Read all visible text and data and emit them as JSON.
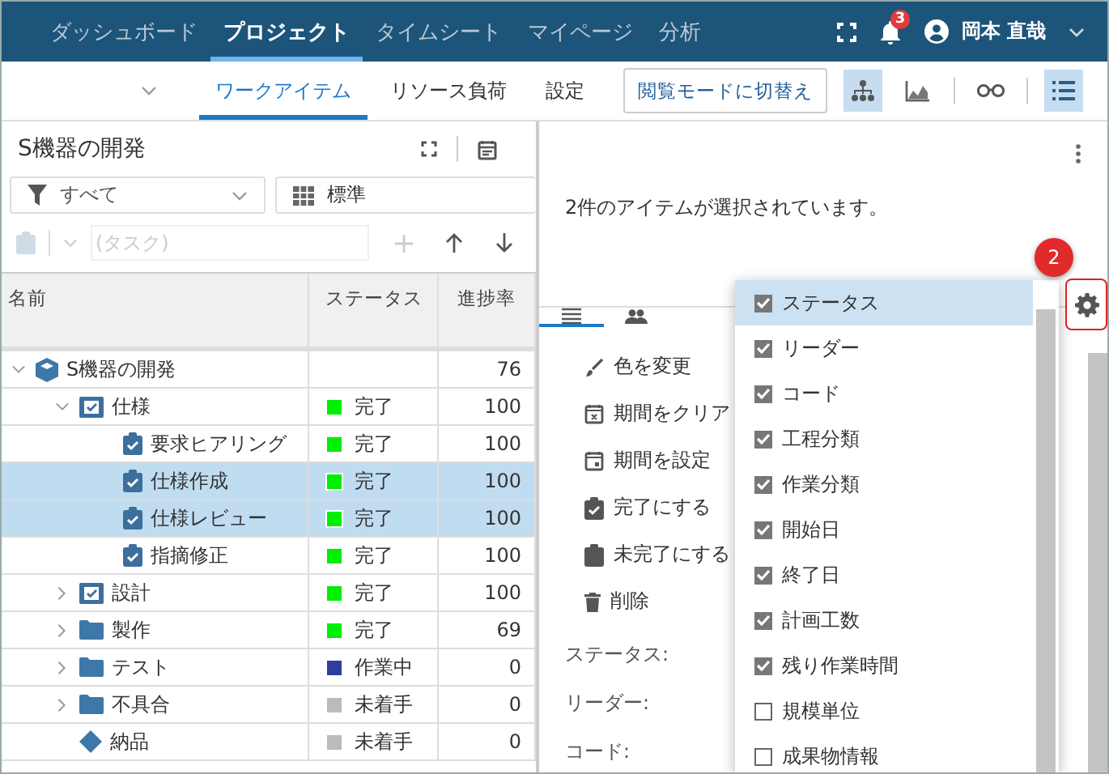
{
  "nav": {
    "items": [
      {
        "label": "ダッシュボード",
        "selected": false
      },
      {
        "label": "プロジェクト",
        "selected": true
      },
      {
        "label": "タイムシート",
        "selected": false
      },
      {
        "label": "マイページ",
        "selected": false
      },
      {
        "label": "分析",
        "selected": false
      }
    ],
    "notification_count": "3",
    "user_name": "岡本 直哉"
  },
  "subnav": {
    "tabs": [
      {
        "label": "ワークアイテム",
        "selected": true
      },
      {
        "label": "リソース負荷",
        "selected": false
      },
      {
        "label": "設定",
        "selected": false
      }
    ],
    "mode_button": "閲覧モードに切替え",
    "view_buttons": [
      {
        "kind": "hierarchy",
        "selected": true
      },
      {
        "kind": "chart",
        "selected": false
      },
      {
        "kind": "glasses",
        "selected": false
      },
      {
        "kind": "list",
        "selected": true
      }
    ]
  },
  "left": {
    "title": "S機器の開発",
    "filter": "すべて",
    "view": "標準",
    "new_item_placeholder": "(タスク)",
    "table": {
      "columns": [
        "名前",
        "ステータス",
        "進捗率"
      ],
      "rows": [
        {
          "kind": "project",
          "name": "S機器の開発",
          "status": "",
          "progress": "76",
          "selected": false,
          "expanded": true,
          "children": [
            {
              "kind": "summary",
              "name": "仕様",
              "status": "完了",
              "color": "#00ee00",
              "progress": "100",
              "selected": false,
              "expanded": true,
              "children": [
                {
                  "kind": "task",
                  "name": "要求ヒアリング",
                  "status": "完了",
                  "color": "#00ee00",
                  "progress": "100",
                  "selected": false
                },
                {
                  "kind": "task",
                  "name": "仕様作成",
                  "status": "完了",
                  "color": "#00ee00",
                  "progress": "100",
                  "selected": true
                },
                {
                  "kind": "task",
                  "name": "仕様レビュー",
                  "status": "完了",
                  "color": "#00ee00",
                  "progress": "100",
                  "selected": true
                },
                {
                  "kind": "task",
                  "name": "指摘修正",
                  "status": "完了",
                  "color": "#00ee00",
                  "progress": "100",
                  "selected": false
                }
              ]
            },
            {
              "kind": "summary",
              "name": "設計",
              "status": "完了",
              "color": "#00ee00",
              "progress": "100",
              "selected": false,
              "expanded": false
            },
            {
              "kind": "folder",
              "name": "製作",
              "status": "完了",
              "color": "#00ee00",
              "progress": "69",
              "selected": false,
              "expanded": false
            },
            {
              "kind": "folder",
              "name": "テスト",
              "status": "作業中",
              "color": "#2e3e9e",
              "progress": "0",
              "selected": false,
              "expanded": false
            },
            {
              "kind": "folder",
              "name": "不具合",
              "status": "未着手",
              "color": "#bbbbbb",
              "progress": "0",
              "selected": false,
              "expanded": false
            },
            {
              "kind": "milestone",
              "name": "納品",
              "status": "未着手",
              "color": "#bbbbbb",
              "progress": "0",
              "selected": false
            }
          ]
        }
      ]
    }
  },
  "right": {
    "message": "2件のアイテムが選択されています。",
    "tabs": [
      {
        "kind": "list",
        "selected": true
      },
      {
        "kind": "people",
        "selected": false
      }
    ],
    "actions": [
      {
        "kind": "brush",
        "label": "色を変更"
      },
      {
        "kind": "calendar-x",
        "label": "期間をクリア"
      },
      {
        "kind": "calendar",
        "label": "期間を設定"
      },
      {
        "kind": "clipboard-check",
        "label": "完了にする"
      },
      {
        "kind": "clipboard",
        "label": "未完了にする"
      },
      {
        "kind": "trash",
        "label": "削除"
      }
    ],
    "fields": [
      "ステータス:",
      "リーダー:",
      "コード:"
    ],
    "step_badge": "2",
    "column_menu": [
      {
        "label": "ステータス",
        "checked": true,
        "selected": true
      },
      {
        "label": "リーダー",
        "checked": true,
        "selected": false
      },
      {
        "label": "コード",
        "checked": true,
        "selected": false
      },
      {
        "label": "工程分類",
        "checked": true,
        "selected": false
      },
      {
        "label": "作業分類",
        "checked": true,
        "selected": false
      },
      {
        "label": "開始日",
        "checked": true,
        "selected": false
      },
      {
        "label": "終了日",
        "checked": true,
        "selected": false
      },
      {
        "label": "計画工数",
        "checked": true,
        "selected": false
      },
      {
        "label": "残り作業時間",
        "checked": true,
        "selected": false
      },
      {
        "label": "規模単位",
        "checked": false,
        "selected": false
      },
      {
        "label": "成果物情報",
        "checked": false,
        "selected": false
      }
    ]
  }
}
